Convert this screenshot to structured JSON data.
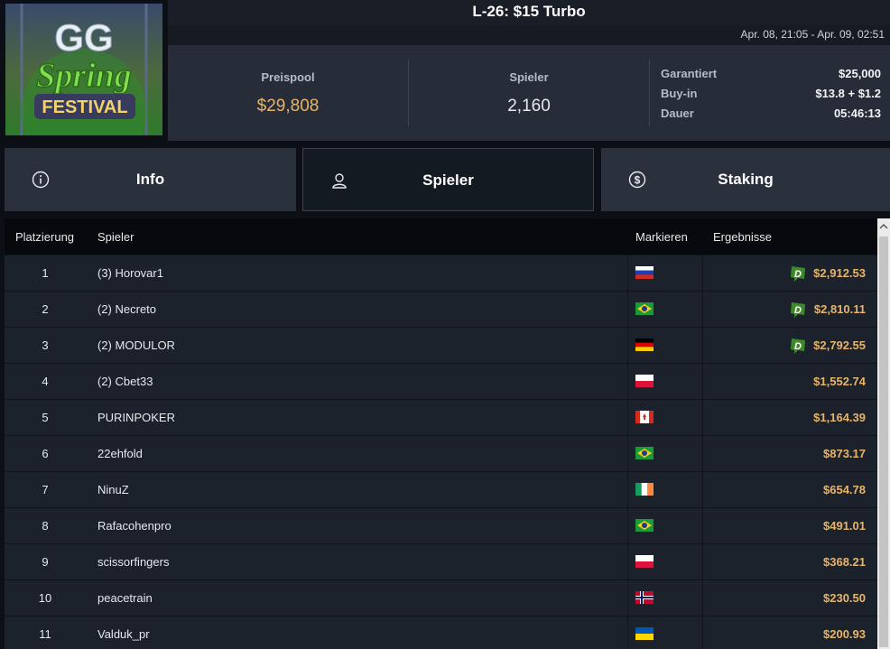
{
  "header": {
    "title": "L-26: $15 Turbo",
    "date_range": "Apr. 08, 21:05 - Apr. 09, 02:51",
    "logo_text": "GG Spring FESTIVAL"
  },
  "stats": {
    "prize_pool_label": "Preispool",
    "prize_pool_value": "$29,808",
    "players_label": "Spieler",
    "players_value": "2,160",
    "guaranteed_label": "Garantiert",
    "guaranteed_value": "$25,000",
    "buyin_label": "Buy-in",
    "buyin_value": "$13.8 + $1.2",
    "duration_label": "Dauer",
    "duration_value": "05:46:13"
  },
  "tabs": [
    {
      "label": "Info",
      "icon": "info-icon"
    },
    {
      "label": "Spieler",
      "icon": "user-icon",
      "active": true
    },
    {
      "label": "Staking",
      "icon": "dollar-coin-icon"
    }
  ],
  "table": {
    "headers": {
      "rank": "Platzierung",
      "player": "Spieler",
      "flag": "Markieren",
      "result": "Ergebnisse"
    },
    "rows": [
      {
        "rank": "1",
        "name": "(3) Horovar1",
        "country": "russia",
        "result": "$2,912.53",
        "badge": true
      },
      {
        "rank": "2",
        "name": "(2) Necreto",
        "country": "brazil",
        "result": "$2,810.11",
        "badge": true
      },
      {
        "rank": "3",
        "name": "(2) MODULOR",
        "country": "germany",
        "result": "$2,792.55",
        "badge": true
      },
      {
        "rank": "4",
        "name": "(2) Cbet33",
        "country": "poland",
        "result": "$1,552.74",
        "badge": false
      },
      {
        "rank": "5",
        "name": "PURINPOKER",
        "country": "canada",
        "result": "$1,164.39",
        "badge": false
      },
      {
        "rank": "6",
        "name": "22ehfold",
        "country": "brazil",
        "result": "$873.17",
        "badge": false
      },
      {
        "rank": "7",
        "name": "NinuZ",
        "country": "ireland",
        "result": "$654.78",
        "badge": false
      },
      {
        "rank": "8",
        "name": "Rafacohenpro",
        "country": "brazil",
        "result": "$491.01",
        "badge": false
      },
      {
        "rank": "9",
        "name": "scissorfingers",
        "country": "poland",
        "result": "$368.21",
        "badge": false
      },
      {
        "rank": "10",
        "name": "peacetrain",
        "country": "norway",
        "result": "$230.50",
        "badge": false
      },
      {
        "rank": "11",
        "name": "Valduk_pr",
        "country": "ukraine",
        "result": "$200.93",
        "badge": false
      }
    ]
  },
  "colors": {
    "accent_gold": "#e7b46a",
    "badge_green": "#3e8a2a",
    "active_tab_bg": "#141a22"
  }
}
